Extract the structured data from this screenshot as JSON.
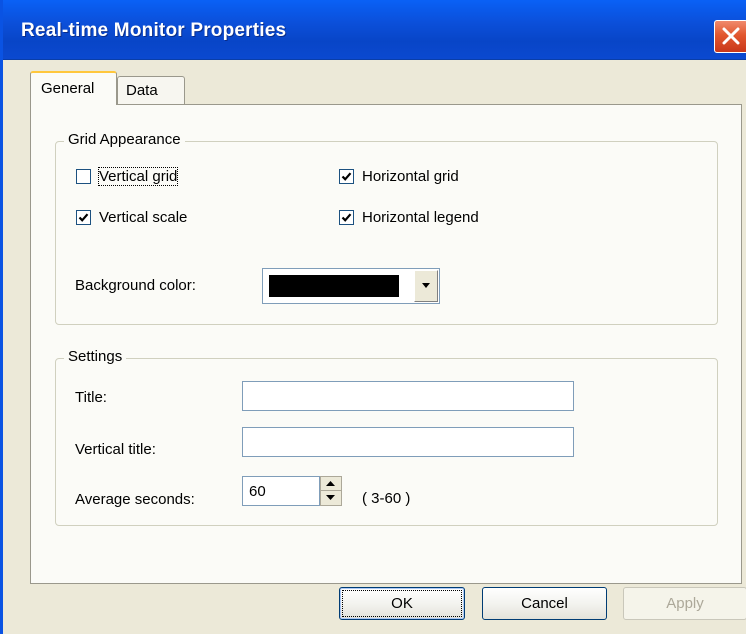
{
  "window": {
    "title": "Real-time Monitor Properties"
  },
  "tabs": [
    {
      "label": "General",
      "active": true
    },
    {
      "label": "Data",
      "active": false
    }
  ],
  "grid_appearance": {
    "label": "Grid Appearance",
    "vertical_grid": {
      "label": "Vertical grid",
      "checked": false
    },
    "horizontal_grid": {
      "label": "Horizontal grid",
      "checked": true
    },
    "vertical_scale": {
      "label": "Vertical scale",
      "checked": true
    },
    "horizontal_legend": {
      "label": "Horizontal legend",
      "checked": true
    },
    "background_color": {
      "label": "Background color:",
      "value": "#000000"
    }
  },
  "settings": {
    "label": "Settings",
    "title": {
      "label": "Title:",
      "value": ""
    },
    "vertical_title": {
      "label": "Vertical title:",
      "value": ""
    },
    "average_seconds": {
      "label": "Average seconds:",
      "value": "60",
      "range": "( 3-60 )"
    }
  },
  "buttons": {
    "ok": "OK",
    "cancel": "Cancel",
    "apply": "Apply"
  },
  "colors": {
    "titlebar": "#0b4fd9",
    "dialog_bg": "#ece9d8",
    "close": "#e2572f"
  }
}
